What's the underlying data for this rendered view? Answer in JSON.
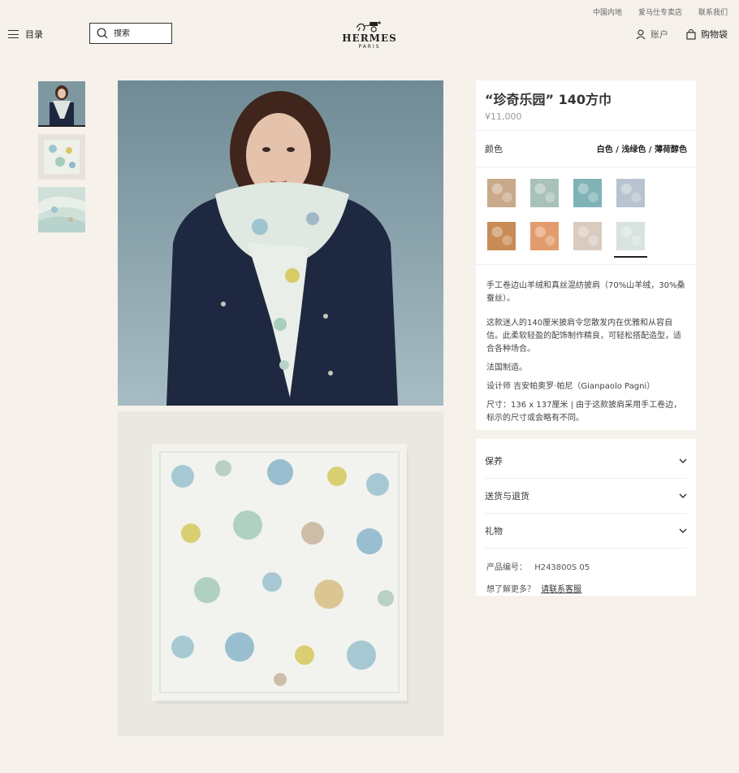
{
  "utility_links": [
    "中国内地",
    "爱马仕专卖店",
    "联系我们"
  ],
  "header": {
    "menu_label": "目录",
    "search_placeholder": "搜索",
    "brand": "HERMES",
    "city": "PARIS",
    "account_label": "账户",
    "cart_label": "购物袋"
  },
  "product": {
    "title": "“珍奇乐园” 140方巾",
    "price": "¥11,000",
    "color_label": "颜色",
    "selected_color": "白色 / 浅绿色 / 薄荷醇色",
    "swatch_colors": [
      "#c8a98a",
      "#a9c2b8",
      "#7fb3b6",
      "#b7c3cf",
      "#c98b55",
      "#e39c6e",
      "#d9cbbf",
      "#d7e3df"
    ],
    "description": [
      "手工卷边山羊绒和真丝混纺披肩（70%山羊绒，30%桑蚕丝）。",
      "这款迷人的140厘米披肩令您散发内在优雅和从容自信。此柔软轻盈的配饰制作精良，可轻松搭配造型，适合各种场合。",
      "法国制造。",
      "设计师 吉安帕奥罗·帕尼（Gianpaolo Pagni）",
      "尺寸：136 x 137厘米 | 由于这款披肩采用手工卷边，标示的尺寸或会略有不同。"
    ]
  },
  "accordions": [
    "保养",
    "送货与退货",
    "礼物"
  ],
  "meta": {
    "product_code_label": "产品编号：",
    "product_code": "H243800S 05",
    "more_question": "想了解更多？",
    "contact_link": "请联系客服"
  }
}
